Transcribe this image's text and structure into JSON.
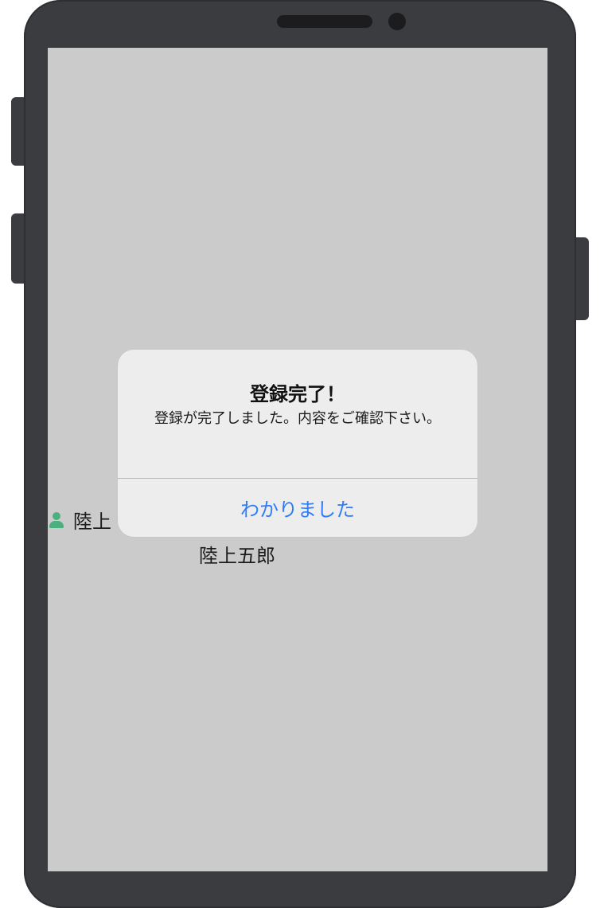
{
  "list": {
    "user_label": "陸上",
    "name": "陸上五郎"
  },
  "alert": {
    "title": "登録完了！",
    "message": "登録が完了しました。内容をご確認下さい。",
    "ok_button": "わかりました"
  },
  "colors": {
    "accent": "#2f7cf6",
    "person_icon": "#4caf7d",
    "screen_background": "#cbcbcb",
    "alert_background": "#ededed",
    "phone_frame": "#3b3c40"
  }
}
